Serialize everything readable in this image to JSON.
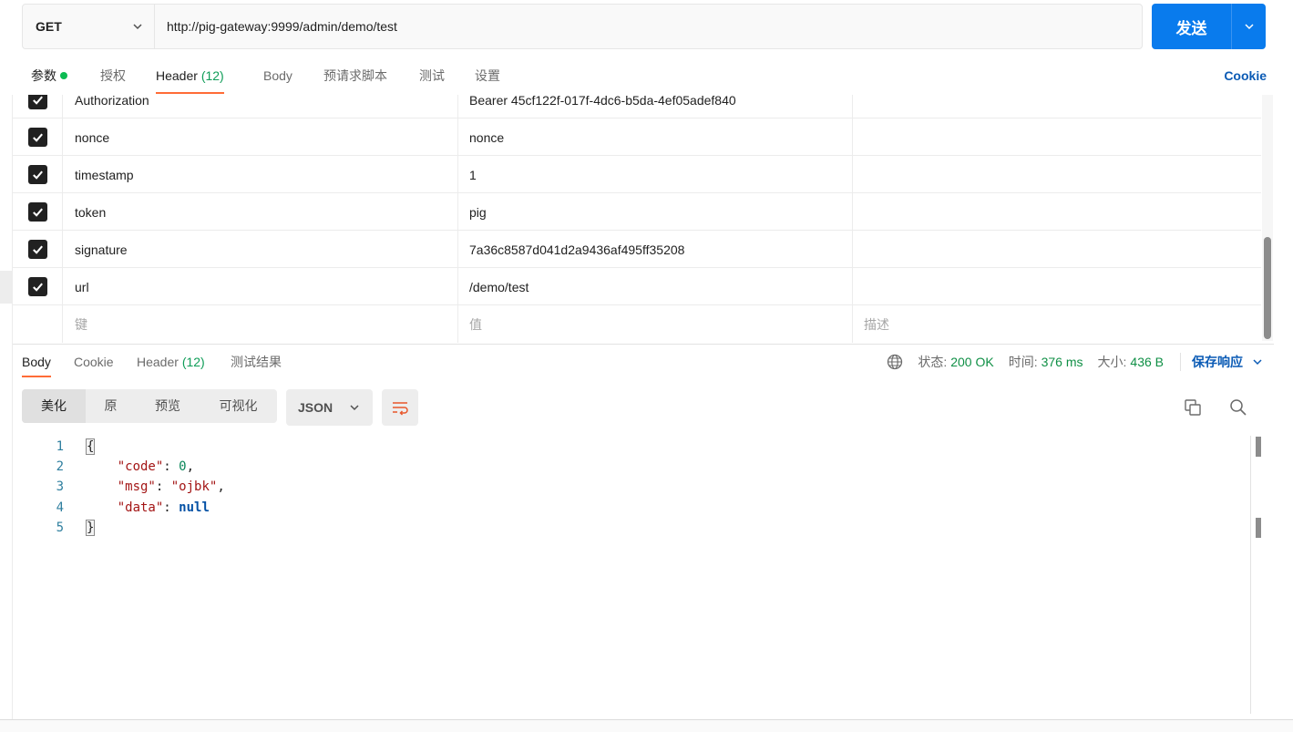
{
  "request": {
    "method": "GET",
    "url": "http://pig-gateway:9999/admin/demo/test",
    "send_label": "发送"
  },
  "request_tabs": {
    "params": "参数",
    "auth": "授权",
    "header": "Header",
    "header_count": "(12)",
    "body": "Body",
    "prerequest": "预请求脚本",
    "tests": "测试",
    "settings": "设置",
    "cookie": "Cookie"
  },
  "headers": {
    "rows": [
      {
        "key": "Authorization",
        "value": "Bearer  45cf122f-017f-4dc6-b5da-4ef05adef840",
        "checked": true
      },
      {
        "key": "nonce",
        "value": "nonce",
        "checked": true
      },
      {
        "key": "timestamp",
        "value": "1",
        "checked": true
      },
      {
        "key": "token",
        "value": "pig",
        "checked": true
      },
      {
        "key": "signature",
        "value": "7a36c8587d041d2a9436af495ff35208",
        "checked": true
      },
      {
        "key": "url",
        "value": "/demo/test",
        "checked": true
      }
    ],
    "placeholder": {
      "key": "键",
      "value": "值",
      "description": "描述"
    }
  },
  "response_tabs": {
    "body": "Body",
    "cookie": "Cookie",
    "header": "Header",
    "header_count": "(12)",
    "test_results": "测试结果"
  },
  "response_status": {
    "status_label": "状态:",
    "status_value": "200 OK",
    "time_label": "时间:",
    "time_value": "376 ms",
    "size_label": "大小:",
    "size_value": "436 B",
    "save_label": "保存响应"
  },
  "view_modes": {
    "pretty": "美化",
    "raw": "原",
    "preview": "预览",
    "visualize": "可视化"
  },
  "format": "JSON",
  "code": {
    "line_numbers": [
      "1",
      "2",
      "3",
      "4",
      "5"
    ],
    "open_brace": "{",
    "close_brace": "}",
    "entries": [
      {
        "key": "\"code\"",
        "value": "0",
        "type": "number",
        "comma": ","
      },
      {
        "key": "\"msg\"",
        "value": "\"ojbk\"",
        "type": "string",
        "comma": ","
      },
      {
        "key": "\"data\"",
        "value": "null",
        "type": "null",
        "comma": ""
      }
    ]
  },
  "icons": {
    "method_dropdown": "chevron-down-icon",
    "send_dropdown": "chevron-down-icon",
    "checkbox": "check-icon",
    "globe": "globe-icon",
    "wrap": "wrap-lines-icon",
    "copy": "copy-icon",
    "search": "search-icon"
  },
  "colors": {
    "accent": "#ff6c37",
    "primary": "#097bed",
    "link": "#0b5bb5",
    "success": "#0f8f45"
  }
}
